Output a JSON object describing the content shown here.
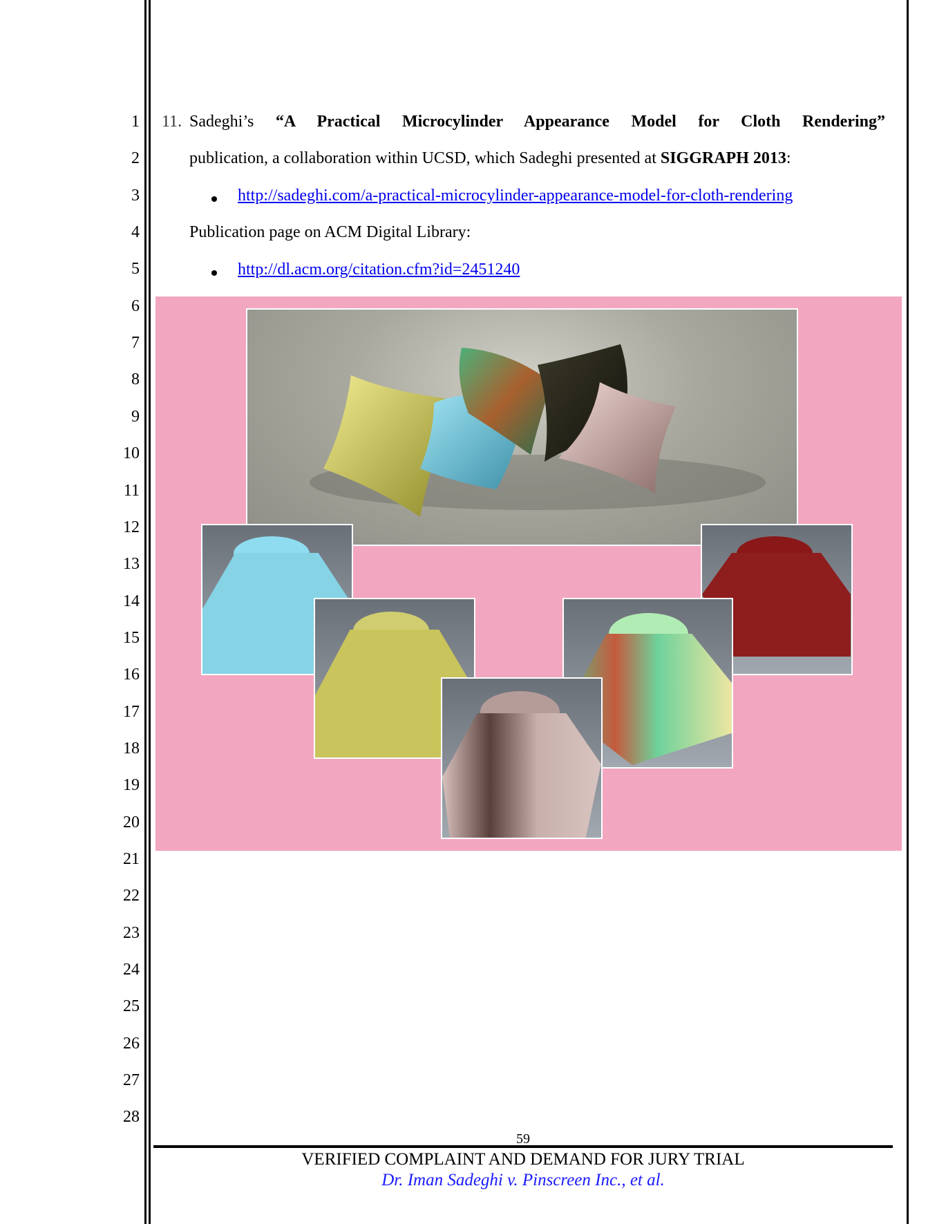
{
  "line_numbers": [
    "1",
    "2",
    "3",
    "4",
    "5",
    "6",
    "7",
    "8",
    "9",
    "10",
    "11",
    "12",
    "13",
    "14",
    "15",
    "16",
    "17",
    "18",
    "19",
    "20",
    "21",
    "22",
    "23",
    "24",
    "25",
    "26",
    "27",
    "28"
  ],
  "paragraph": {
    "number": "11.",
    "lead": "Sadeghi’s",
    "title": "“A Practical Microcylinder Appearance Model for Cloth Rendering”",
    "line2_pre": "publication, a collaboration within UCSD, which Sadeghi presented at",
    "line2_bold": "SIGGRAPH 2013",
    "line2_post": ":",
    "link1": "http://sadeghi.com/a-practical-microcylinder-appearance-model-for-cloth-rendering",
    "line4": "Publication page on ACM Digital Library:",
    "link2": "http://dl.acm.org/citation.cfm?id=2451240"
  },
  "figure": {
    "background_color": "#f2a6bf",
    "description": "Collage of cloth renderings: pillows and draped cloths",
    "top_image": "pillows-render",
    "thumbnails": [
      "cyan-drape",
      "yellow-drape",
      "pink-drape",
      "green-iridescent-drape",
      "red-drape"
    ]
  },
  "footer": {
    "page_number": "59",
    "title": "VERIFIED COMPLAINT AND DEMAND FOR JURY TRIAL",
    "subtitle": "Dr. Iman Sadeghi v. Pinscreen Inc., et al."
  },
  "colors": {
    "link": "#0000ee",
    "subtitle": "#1a1aff"
  }
}
